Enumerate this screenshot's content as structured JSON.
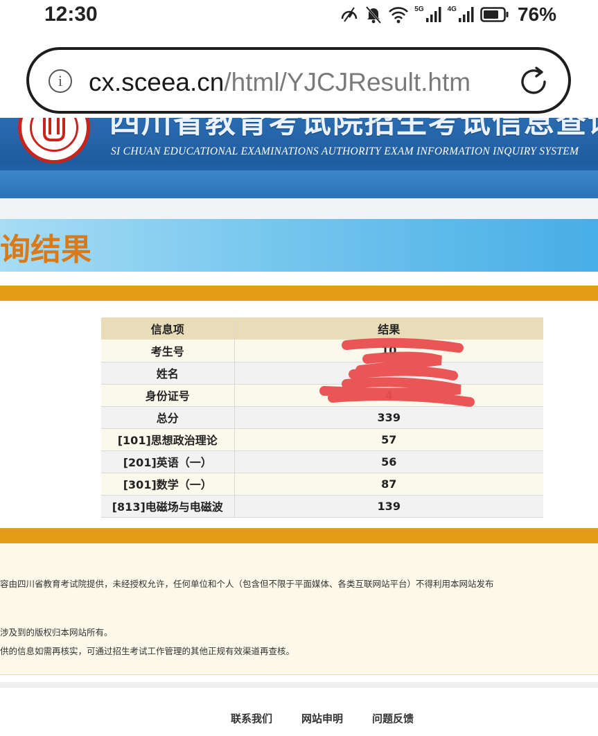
{
  "status_bar": {
    "time": "12:30",
    "net_5g": "5G",
    "net_4g": "4G",
    "battery": "76%",
    "icons": [
      "speed-icon",
      "bell-muted-icon",
      "wifi-icon",
      "signal-icon",
      "signal-icon",
      "battery-icon"
    ]
  },
  "url_bar": {
    "domain": "cx.sceea.cn",
    "path": "/html/YJCJResult.htm",
    "info_glyph": "i"
  },
  "header": {
    "title_cn": "四川省教育考试院招生考试信息查询系统",
    "title_en": "SI CHUAN EDUCATIONAL EXAMINATIONS AUTHORITY EXAM INFORMATION INQUIRY SYSTEM",
    "colors": {
      "header_blue": "#1f5c9f",
      "logo_red": "#c8241e"
    }
  },
  "banner": {
    "title": "询结果",
    "color": "#d97917"
  },
  "table": {
    "headers": [
      "信息项",
      "结果"
    ],
    "rows": [
      {
        "label": "考生号",
        "value": "10"
      },
      {
        "label": "姓名",
        "value": ""
      },
      {
        "label": "身份证号",
        "value": "4"
      },
      {
        "label": "总分",
        "value": "339"
      },
      {
        "label": "[101]思想政治理论",
        "value": "57"
      },
      {
        "label": "[201]英语（一）",
        "value": "56"
      },
      {
        "label": "[301]数学（一）",
        "value": "87"
      },
      {
        "label": "[813]电磁场与电磁波",
        "value": "139"
      }
    ]
  },
  "disclaimer": {
    "line1": "容由四川省教育考试院提供，未经授权允许，任何单位和个人（包含但不限于平面媒体、各类互联网站平台）不得利用本网站发布",
    "line2": "涉及到的版权归本网站所有。",
    "line3": "供的信息如需再核实，可通过招生考试工作管理的其他正规有效渠道再查核。"
  },
  "footer": {
    "links": [
      "联系我们",
      "网站申明",
      "问题反馈"
    ]
  },
  "colors": {
    "gold_bar": "#e49c16",
    "banner_blue": "#47aee6",
    "table_header": "#e9dcb8",
    "redaction": "#ea4d4d"
  }
}
